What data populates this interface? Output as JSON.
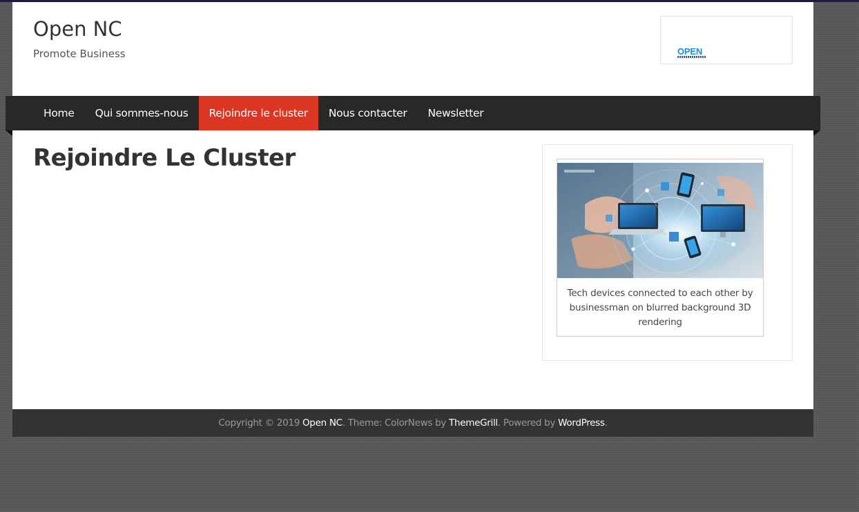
{
  "site": {
    "title": "Open NC",
    "description": "Promote Business",
    "logo_text": "OPEN"
  },
  "nav": {
    "items": [
      {
        "label": "Home",
        "active": false
      },
      {
        "label": "Qui sommes-nous",
        "active": false
      },
      {
        "label": "Rejoindre le cluster",
        "active": true
      },
      {
        "label": "Nous contacter",
        "active": false
      },
      {
        "label": "Newsletter",
        "active": false
      }
    ]
  },
  "main": {
    "title": "Rejoindre Le Cluster"
  },
  "sidebar": {
    "image_caption": "Tech devices connected to each other by businessman on blurred background 3D rendering"
  },
  "footer": {
    "copyright": "Copyright © 2019 ",
    "site_link": "Open NC",
    "theme_text": ". Theme: ColorNews by ",
    "theme_link": "ThemeGrill",
    "powered_text": ". Powered by ",
    "powered_link": "WordPress",
    "end": "."
  },
  "colors": {
    "accent": "#dc3522",
    "nav_background": "#282828",
    "footer_background": "#333333",
    "page_background": "#585858"
  }
}
